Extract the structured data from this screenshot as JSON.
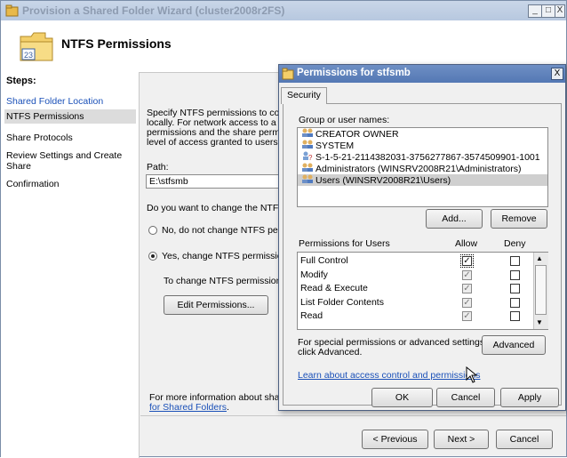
{
  "wizard": {
    "title": "Provision a Shared Folder Wizard (cluster2008r2FS)",
    "header_title": "NTFS Permissions",
    "window_buttons": [
      "_",
      "□",
      "X"
    ],
    "steps_heading": "Steps:",
    "steps": [
      {
        "label": "Shared Folder Location"
      },
      {
        "label": "NTFS Permissions"
      },
      {
        "label": "Share Protocols"
      },
      {
        "label": "Review Settings and Create Share"
      },
      {
        "label": "Confirmation"
      }
    ],
    "description_lines": [
      "Specify NTFS permissions to contro",
      "locally. For network access to a sha",
      "permissions and the share permissio",
      "level of access granted to users an"
    ],
    "path_label": "Path:",
    "path_value": "E:\\stfsmb",
    "question": "Do you want to change the NTFS",
    "radio_no": "No, do not change NTFS perm",
    "radio_yes": "Yes, change NTFS permission",
    "change_text": "To change NTFS permissions,",
    "edit_button": "Edit Permissions...",
    "more_info_prefix": "For more information about shari",
    "more_info_link": "for Shared Folders",
    "more_info_suffix": ".",
    "nav": {
      "previous": "< Previous",
      "next": "Next >",
      "cancel": "Cancel"
    }
  },
  "dialog": {
    "title": "Permissions for stfsmb",
    "close": "X",
    "tab": "Security",
    "group_label": "Group or user names:",
    "users": [
      {
        "name": "CREATOR OWNER",
        "icon": "users-group-icon",
        "selected": false
      },
      {
        "name": "SYSTEM",
        "icon": "users-group-icon",
        "selected": false
      },
      {
        "name": "S-1-5-21-2114382031-3756277867-3574509901-1001",
        "icon": "unknown-user-icon",
        "selected": false
      },
      {
        "name": "Administrators (WINSRV2008R21\\Administrators)",
        "icon": "users-group-icon",
        "selected": false
      },
      {
        "name": "Users (WINSRV2008R21\\Users)",
        "icon": "users-group-icon",
        "selected": true
      }
    ],
    "add_button": "Add...",
    "remove_button": "Remove",
    "perm_header": "Permissions for Users",
    "allow_header": "Allow",
    "deny_header": "Deny",
    "permissions": [
      {
        "name": "Full Control",
        "allow": true,
        "allow_grayed": false,
        "deny": false
      },
      {
        "name": "Modify",
        "allow": true,
        "allow_grayed": true,
        "deny": false
      },
      {
        "name": "Read & Execute",
        "allow": true,
        "allow_grayed": true,
        "deny": false
      },
      {
        "name": "List Folder Contents",
        "allow": true,
        "allow_grayed": true,
        "deny": false
      },
      {
        "name": "Read",
        "allow": true,
        "allow_grayed": true,
        "deny": false
      }
    ],
    "special_text_line1": "For special permissions or advanced settings,",
    "special_text_line2": "click Advanced.",
    "advanced_button": "Advanced",
    "learn_link": "Learn about access control and permissions",
    "ok": "OK",
    "cancel": "Cancel",
    "apply": "Apply"
  },
  "colors": {
    "selected_row": "#cfcfcf",
    "link": "#1a50b8",
    "dialog_title": "#5478b4"
  }
}
